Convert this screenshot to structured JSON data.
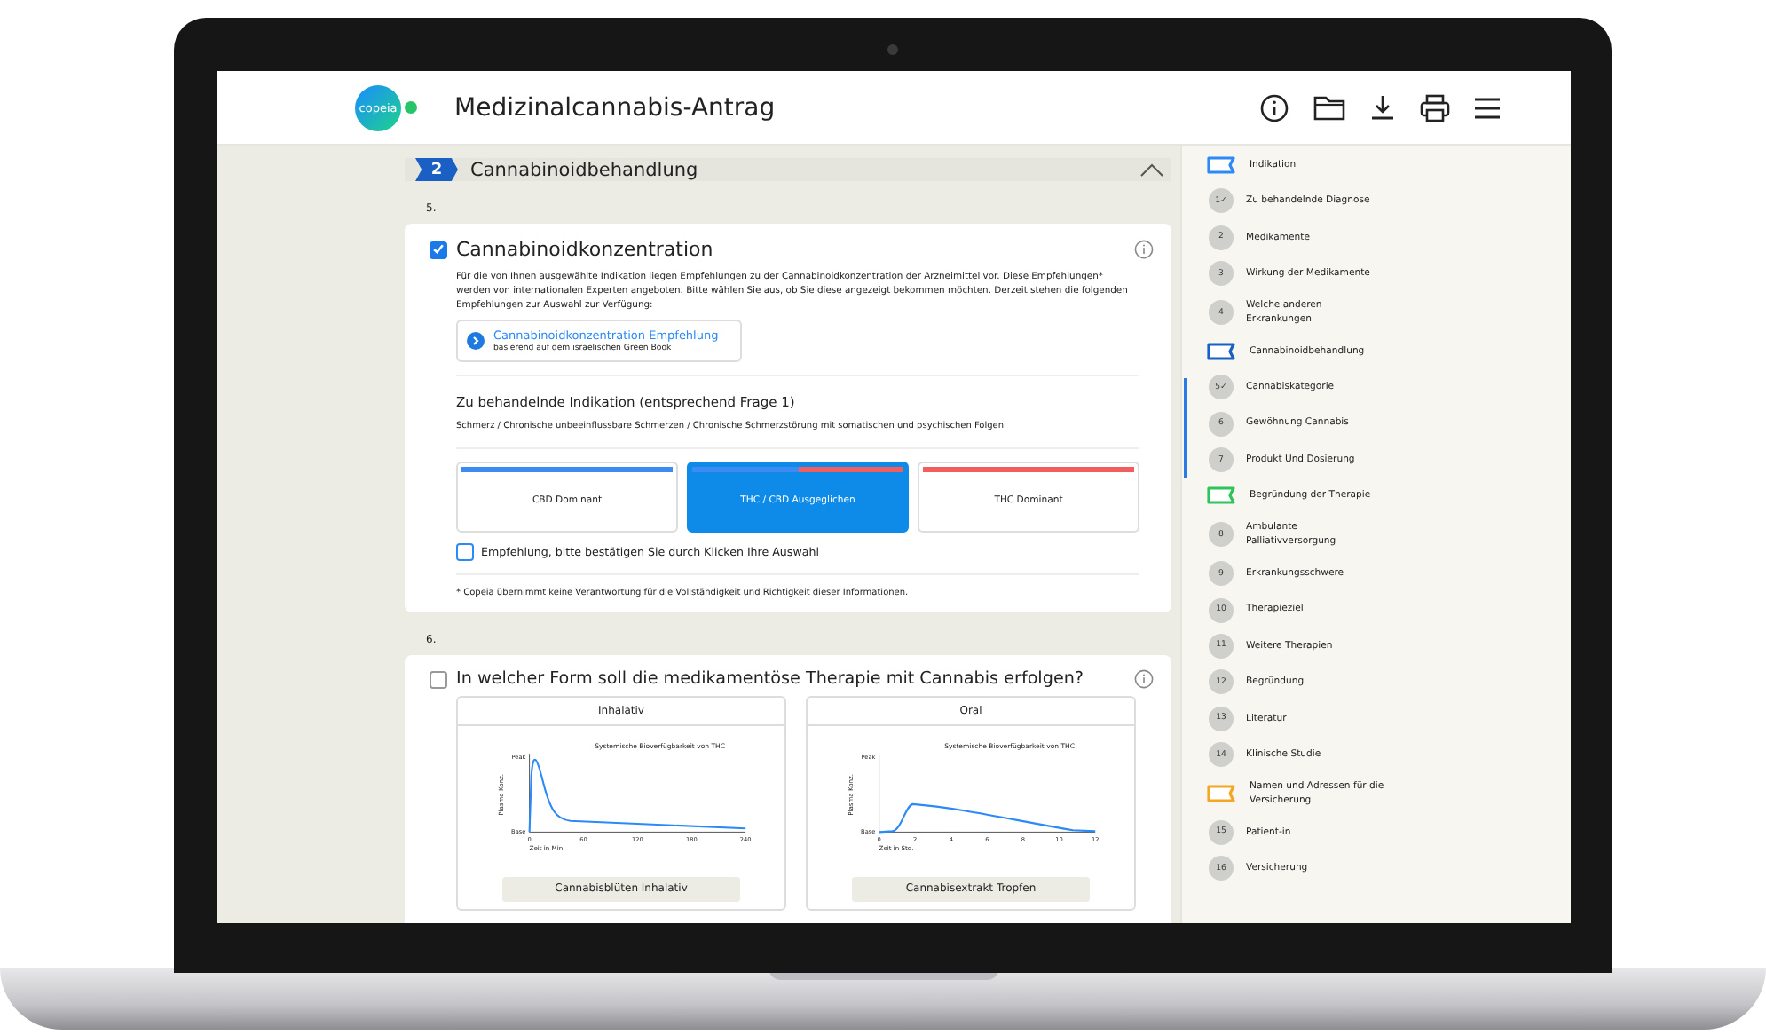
{
  "app": {
    "logo": "copeia",
    "title": "Medizinalcannabis-Antrag"
  },
  "section": {
    "number": "2",
    "title": "Cannabinoidbehandlung",
    "expanded": true
  },
  "questions": [
    {
      "number": "5.",
      "title": "Cannabinoidkonzentration",
      "checked": true,
      "intro": "Für die von Ihnen ausgewählte Indikation liegen Empfehlungen zu der Cannabinoidkonzentration der Arzneimittel vor. Diese Empfehlungen* werden von internationalen Experten angeboten. Bitte wählen Sie aus, ob Sie diese angezeigt bekommen möchten. Derzeit stehen die folgenden Empfehlungen zur Auswahl zur Verfügung:",
      "recommendation": {
        "title": "Cannabinoidkonzentration Empfehlung",
        "subtitle": "basierend auf dem israelischen Green Book"
      },
      "indication_heading": "Zu behandelnde Indikation (entsprechend Frage 1)",
      "indication": "Schmerz / Chronische unbeeinflussbare Schmerzen / Chronische Schmerzstörung mit somatischen und psychischen Folgen",
      "options": [
        {
          "kind": "cbd",
          "label": "CBD Dominant",
          "selected": false
        },
        {
          "kind": "mixed",
          "label": "THC / CBD Ausgeglichen",
          "selected": true
        },
        {
          "kind": "thc",
          "label": "THC Dominant",
          "selected": false
        }
      ],
      "confirm": {
        "label": "Empfehlung, bitte bestätigen Sie durch Klicken Ihre Auswahl",
        "checked": false
      },
      "footnote": "* Copeia übernimmt keine Verantwortung für die Vollständigkeit und Richtigkeit dieser Informationen."
    },
    {
      "number": "6.",
      "title": "In welcher Form soll die medikamentöse Therapie mit Cannabis erfolgen?",
      "checked": false,
      "forms": [
        {
          "label": "Inhalativ",
          "button": "Cannabisblüten Inhalativ",
          "curve": {
            "kind": "fast",
            "title": "Systemische Bioverfügbarkeit von THC",
            "xlabel": "Zeit in Min.",
            "ylabel": "Plasma Konz.",
            "y_top": "Peak",
            "y_bottom": "Base",
            "x_labels": [
              "0",
              "60",
              "120",
              "180",
              "240"
            ]
          }
        },
        {
          "label": "Oral",
          "button": "Cannabisextrakt Tropfen",
          "curve": {
            "kind": "slow",
            "title": "Systemische Bioverfügbarkeit von THC",
            "xlabel": "Zeit in Std.",
            "ylabel": "Plasma Konz.",
            "y_top": "Peak",
            "y_bottom": "Base",
            "x_labels": [
              "0",
              "2",
              "4",
              "6",
              "8",
              "10",
              "12"
            ]
          }
        }
      ]
    }
  ],
  "sidebar": {
    "groups": [
      {
        "label": "Indikation",
        "color": "#2b8af7",
        "active": false,
        "children": [
          {
            "badge": "1✓",
            "label": "Zu behandelnde Diagnose"
          },
          {
            "badge": "2",
            "label": "Medikamente"
          },
          {
            "badge": "3",
            "label": "Wirkung der Medikamente"
          },
          {
            "badge": "4",
            "label": "Welche anderen Erkrankungen"
          }
        ]
      },
      {
        "label": "Cannabinoidbehandlung",
        "color": "#1a5fc4",
        "active": true,
        "children": [
          {
            "badge": "5✓",
            "label": "Cannabiskategorie"
          },
          {
            "badge": "6",
            "label": "Gewöhnung Cannabis"
          },
          {
            "badge": "7",
            "label": "Produkt Und Dosierung"
          }
        ]
      },
      {
        "label": "Begründung der Therapie",
        "color": "#2fc45a",
        "active": false,
        "children": [
          {
            "badge": "8",
            "label": "Ambulante Palliativversorgung"
          },
          {
            "badge": "9",
            "label": "Erkrankungsschwere"
          },
          {
            "badge": "10",
            "label": "Therapieziel"
          },
          {
            "badge": "11",
            "label": "Weitere Therapien"
          },
          {
            "badge": "12",
            "label": "Begründung"
          },
          {
            "badge": "13",
            "label": "Literatur"
          },
          {
            "badge": "14",
            "label": "Klinische Studie"
          }
        ]
      },
      {
        "label": "Namen und Adressen für die Versicherung",
        "color": "#f5a623",
        "active": false,
        "children": [
          {
            "badge": "15",
            "label": "Patient-in"
          },
          {
            "badge": "16",
            "label": "Versicherung"
          }
        ]
      }
    ]
  }
}
